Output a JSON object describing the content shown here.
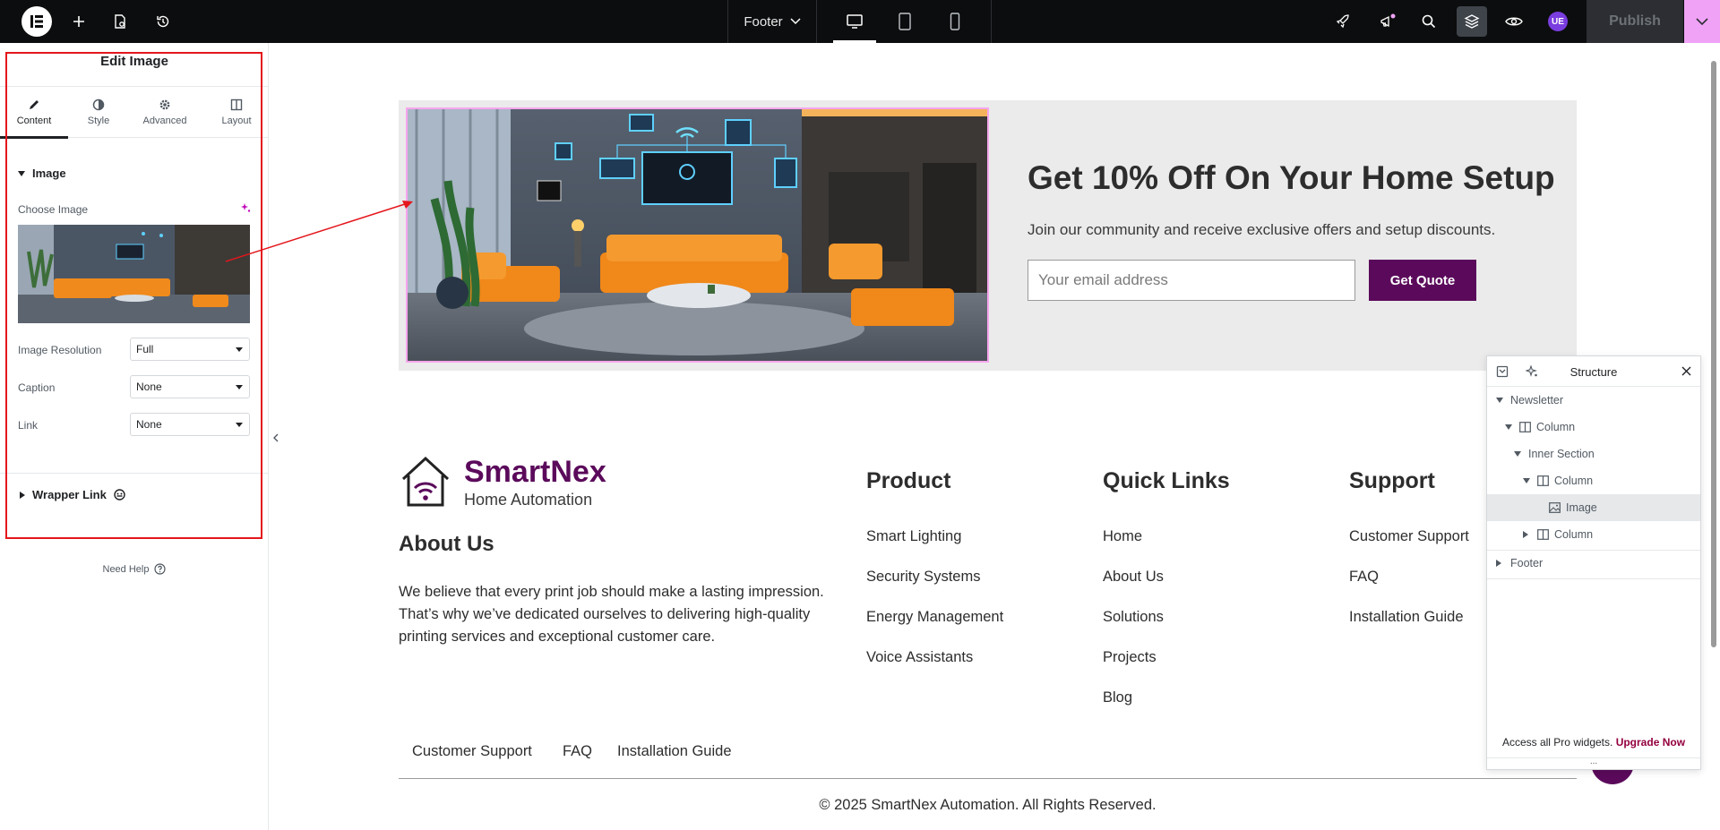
{
  "topbar": {
    "document_name": "Footer",
    "publish_label": "Publish",
    "avatar_initials": "UE",
    "icons": [
      "add-icon",
      "page-settings-icon",
      "history-icon",
      "desktop-icon",
      "tablet-icon",
      "mobile-icon",
      "rocket-icon",
      "whats-new-icon",
      "search-icon",
      "structure-icon",
      "preview-icon"
    ]
  },
  "panel": {
    "title": "Edit Image",
    "tabs": [
      {
        "label": "Content"
      },
      {
        "label": "Style"
      },
      {
        "label": "Advanced"
      },
      {
        "label": "Layout"
      }
    ],
    "section_image": "Image",
    "choose_image_label": "Choose Image",
    "controls": [
      {
        "label": "Image Resolution",
        "value": "Full"
      },
      {
        "label": "Caption",
        "value": "None"
      },
      {
        "label": "Link",
        "value": "None"
      }
    ],
    "wrapper_link": "Wrapper Link",
    "need_help": "Need Help"
  },
  "banner": {
    "title": "Get 10% Off On Your Home Setup",
    "subtitle": "Join our community and receive exclusive offers and setup discounts.",
    "email_placeholder": "Your email address",
    "button_label": "Get Quote"
  },
  "footer": {
    "brand_name": "SmartNex",
    "brand_tagline": "Home Automation",
    "about_title": "About Us",
    "about_text": "We believe that every print job should make a lasting impression. That’s why we’ve dedicated ourselves to delivering high-quality printing services and exceptional customer care.",
    "columns": [
      {
        "title": "Product",
        "links": [
          "Smart Lighting",
          "Security Systems",
          "Energy Management",
          "Voice Assistants"
        ]
      },
      {
        "title": "Quick Links",
        "links": [
          "Home",
          "About Us",
          "Solutions",
          "Projects",
          "Blog"
        ]
      },
      {
        "title": "Support",
        "links": [
          "Customer Support",
          "FAQ",
          "Installation Guide"
        ]
      }
    ],
    "bottom_links": [
      "Customer Support",
      "FAQ",
      "Installation Guide"
    ],
    "copyright": "© 2025 SmartNex Automation. All Rights Reserved."
  },
  "structure": {
    "title": "Structure",
    "tree": [
      "Newsletter",
      "Column",
      "Inner Section",
      "Column",
      "Image",
      "Column",
      "Footer"
    ],
    "promo_text": "Access all Pro widgets.",
    "promo_link": "Upgrade Now"
  },
  "colors": {
    "brand": "#5b0a5b",
    "accent_pink": "#f0a3f6",
    "annotation_red": "#e4161c"
  }
}
